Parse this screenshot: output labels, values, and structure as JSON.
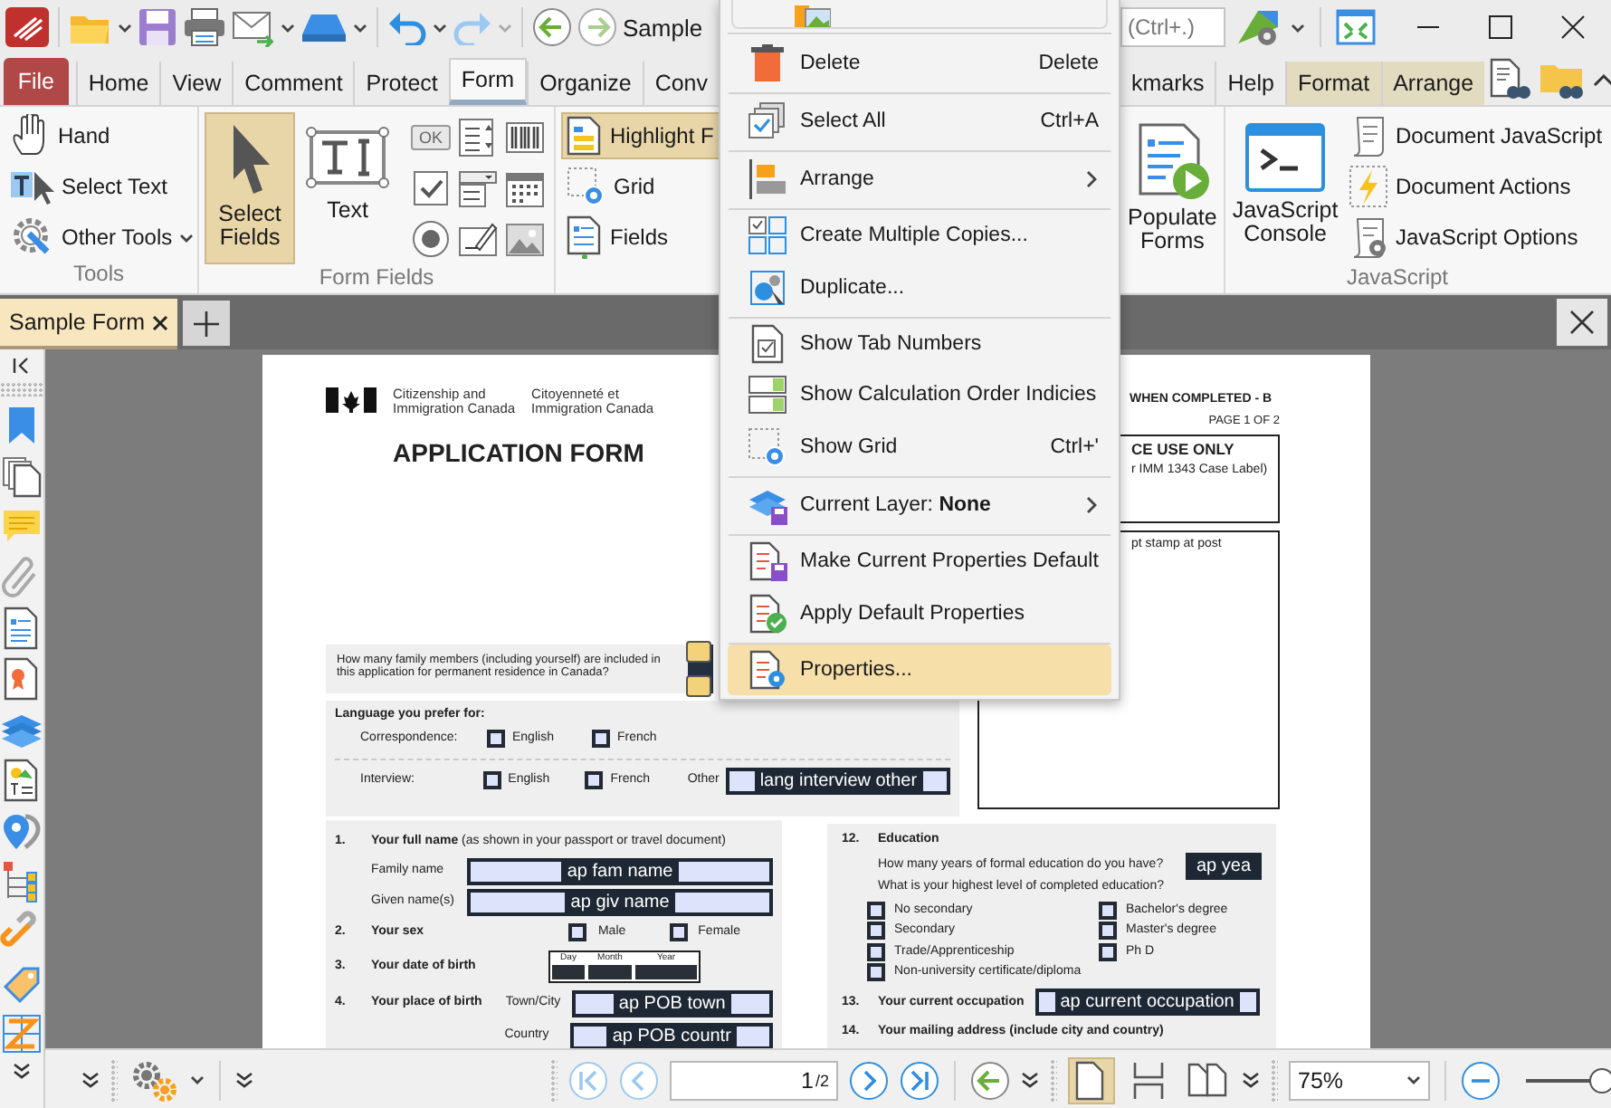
{
  "window": {
    "title": "Sample",
    "search_placeholder": "(Ctrl+.)"
  },
  "tabs": [
    {
      "label": "File",
      "kind": "file",
      "selected": false
    },
    {
      "label": "Home",
      "kind": "tab",
      "selected": false
    },
    {
      "label": "View",
      "kind": "tab",
      "selected": false
    },
    {
      "label": "Comment",
      "kind": "tab",
      "selected": false
    },
    {
      "label": "Protect",
      "kind": "tab",
      "selected": false
    },
    {
      "label": "Form",
      "kind": "tab",
      "selected": true
    },
    {
      "label": "Organize",
      "kind": "tab",
      "selected": false
    },
    {
      "label": "Conv",
      "kind": "tab",
      "selected": false
    }
  ],
  "tabs_right": [
    {
      "label": "kmarks",
      "kind": "tab",
      "selected": false
    },
    {
      "label": "Help",
      "kind": "tab",
      "selected": false
    },
    {
      "label": "Format",
      "kind": "contextual",
      "selected": false
    },
    {
      "label": "Arrange",
      "kind": "contextual",
      "selected": false
    }
  ],
  "ribbon": {
    "tools": {
      "items": [
        {
          "label": "Hand",
          "dropdown": false
        },
        {
          "label": "Select Text",
          "dropdown": false
        },
        {
          "label": "Other Tools",
          "dropdown": true
        }
      ],
      "group_label": "Tools"
    },
    "form_fields": {
      "large_buttons": [
        {
          "label": "Select Fields",
          "selected": true
        },
        {
          "label": "Text",
          "selected": false
        }
      ],
      "button_field_text": "OK",
      "group_label": "Form Fields"
    },
    "layout_tools": [
      {
        "label": "Highlight F",
        "selected": true
      },
      {
        "label": "Grid",
        "selected": false
      },
      {
        "label": "Fields",
        "selected": false
      }
    ],
    "populate": {
      "label": "Populate Forms"
    },
    "javascript": {
      "console": "JavaScript Console",
      "items": [
        "Document JavaScript",
        "Document Actions",
        "JavaScript Options"
      ],
      "group_label": "JavaScript"
    }
  },
  "context_menu": {
    "items": [
      {
        "label": "Delete",
        "shortcut": "Delete",
        "submenu": false,
        "selected": false,
        "separator_after": true
      },
      {
        "label": "Select All",
        "shortcut": "Ctrl+A",
        "submenu": false,
        "selected": false,
        "separator_after": true
      },
      {
        "label": "Arrange",
        "submenu": true,
        "selected": false,
        "separator_after": true
      },
      {
        "label": "Create Multiple Copies...",
        "submenu": false,
        "selected": false,
        "separator_after": false
      },
      {
        "label": "Duplicate...",
        "submenu": false,
        "selected": false,
        "separator_after": true
      },
      {
        "label": "Show Tab Numbers",
        "submenu": false,
        "selected": false,
        "separator_after": false
      },
      {
        "label": "Show Calculation Order Indicies",
        "submenu": false,
        "selected": false,
        "separator_after": false
      },
      {
        "label": "Show Grid",
        "shortcut": "Ctrl+'",
        "submenu": false,
        "selected": false,
        "separator_after": true
      },
      {
        "label": "Current Layer: **None**",
        "submenu": true,
        "selected": false,
        "separator_after": true
      },
      {
        "label": "Make Current Properties Default",
        "submenu": false,
        "selected": false,
        "separator_after": false
      },
      {
        "label": "Apply Default Properties",
        "submenu": false,
        "selected": false,
        "separator_after": true
      },
      {
        "label": "Properties...",
        "submenu": false,
        "selected": true,
        "separator_after": false
      }
    ]
  },
  "document_tab": {
    "title": "Sample Form",
    "selected": true
  },
  "page": {
    "agency_en": [
      "Citizenship and",
      "Immigration Canada"
    ],
    "agency_fr": [
      "Citoyenneté et",
      "Immigration Canada"
    ],
    "title": "APPLICATION FORM",
    "notice": "WHEN COMPLETED - B",
    "page_number": "PAGE 1 OF 2",
    "office_box": {
      "heading": "CE USE ONLY",
      "text": "r IMM 1343 Case Label)"
    },
    "stamp_box": {
      "text": "pt stamp at post"
    },
    "family_question": "How many family members (including yourself) are included in this application for permanent residence in Canada?",
    "family_field": {
      "selected": true
    },
    "language": {
      "heading": "Language you prefer for:",
      "rows": [
        {
          "label": "Correspondence:",
          "options": [
            {
              "label": "English",
              "checked": false
            },
            {
              "label": "French",
              "checked": false
            }
          ]
        },
        {
          "label": "Interview:",
          "options": [
            {
              "label": "English",
              "checked": false
            },
            {
              "label": "French",
              "checked": false
            }
          ],
          "other_label": "Other",
          "other_field": "lang interview other"
        }
      ]
    },
    "sections_left": [
      {
        "number": "1.",
        "title": "**Your full name** (as shown in your passport or travel document)",
        "kind": "fields",
        "fields": [
          {
            "label": "Family name",
            "value": "ap fam name"
          },
          {
            "label": "Given name(s)",
            "value": "ap giv name"
          }
        ]
      },
      {
        "number": "2.",
        "title": "**Your sex**",
        "kind": "checkboxes",
        "options": [
          {
            "label": "Male",
            "checked": false
          },
          {
            "label": "Female",
            "checked": false
          }
        ]
      },
      {
        "number": "3.",
        "title": "**Your date of birth**",
        "kind": "date",
        "parts": [
          "Day",
          "Month",
          "Year"
        ]
      },
      {
        "number": "4.",
        "title": "**Your place of birth**",
        "kind": "fields",
        "fields": [
          {
            "label": "Town/City",
            "value": "ap POB town"
          },
          {
            "label": "Country",
            "value": "ap POB countr"
          }
        ]
      }
    ],
    "education": {
      "number": "12.",
      "title": "Education",
      "questions": [
        "How many years of formal education do you have?",
        "What is your highest level of completed education?"
      ],
      "years_field": "ap yea",
      "options": [
        {
          "label": "No secondary",
          "checked": false
        },
        {
          "label": "Secondary",
          "checked": false
        },
        {
          "label": "Trade/Apprenticeship",
          "checked": false
        },
        {
          "label": "Non-university certificate/diploma",
          "checked": false
        },
        {
          "label": "Bachelor's degree",
          "checked": false
        },
        {
          "label": "Master's degree",
          "checked": false
        },
        {
          "label": "Ph D",
          "checked": false
        }
      ]
    },
    "occupation": {
      "number": "13.",
      "title": "Your current occupation",
      "field": "ap current occupation"
    },
    "mailing": {
      "number": "14.",
      "title": "Your mailing address (include city and country)"
    }
  },
  "status_bar": {
    "page_value": "1",
    "page_total": "/2",
    "layouts": [
      {
        "selected": true
      },
      {
        "selected": false
      },
      {
        "selected": false
      }
    ],
    "zoom": "75%",
    "zoom_slider": {
      "level": 0.46
    }
  }
}
